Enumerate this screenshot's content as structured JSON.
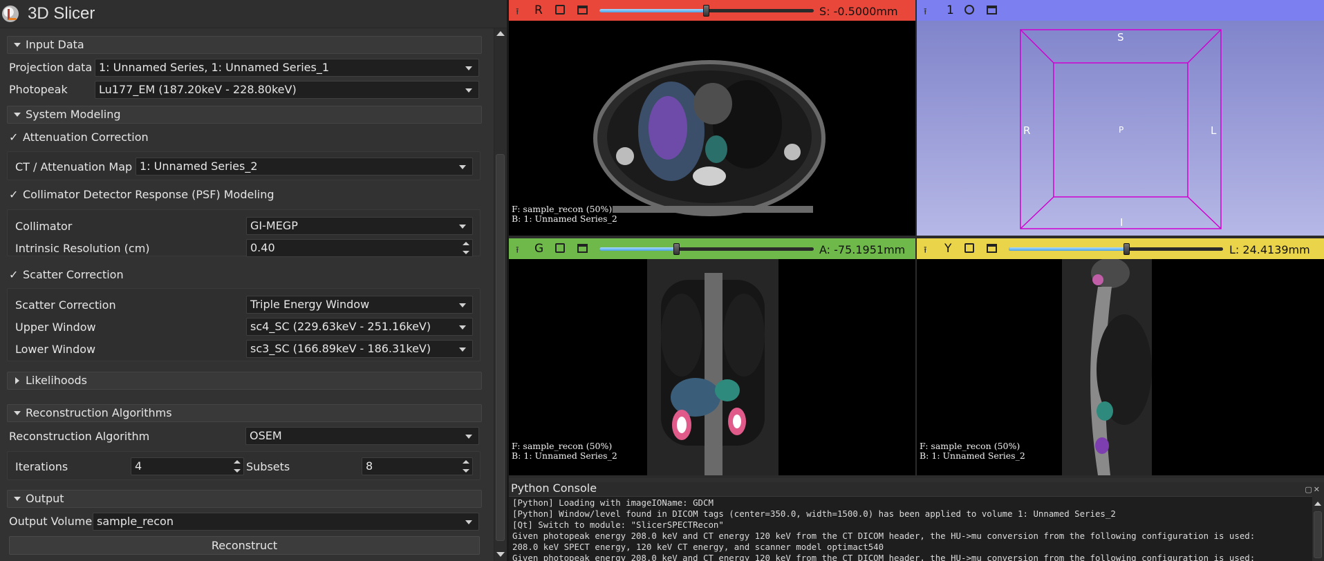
{
  "app": {
    "title": "3D Slicer"
  },
  "sections": {
    "input_data": "Input Data",
    "system_modeling": "System Modeling",
    "likelihoods": "Likelihoods",
    "reconstruction_algorithms": "Reconstruction Algorithms",
    "output": "Output"
  },
  "input_data": {
    "projection_label": "Projection data",
    "projection_value": "1: Unnamed Series, 1: Unnamed Series_1",
    "photopeak_label": "Photopeak",
    "photopeak_value": "Lu177_EM (187.20keV - 228.80keV)"
  },
  "system_modeling": {
    "attenuation_check": "✓",
    "attenuation_label": "Attenuation Correction",
    "ct_map_label": "CT / Attenuation Map",
    "ct_map_value": "1: Unnamed Series_2",
    "psf_check": "✓",
    "psf_label": "Collimator Detector Response (PSF) Modeling",
    "collimator_label": "Collimator",
    "collimator_value": "GI-MEGP",
    "intrinsic_label": "Intrinsic Resolution (cm)",
    "intrinsic_value": "0.40",
    "scatter_check": "✓",
    "scatter_label": "Scatter Correction",
    "scatter_method_label": "Scatter Correction",
    "scatter_method_value": "Triple Energy Window",
    "upper_label": "Upper Window",
    "upper_value": "sc4_SC (229.63keV - 251.16keV)",
    "lower_label": "Lower Window",
    "lower_value": "sc3_SC (166.89keV - 186.31keV)"
  },
  "reconstruction": {
    "algorithm_label": "Reconstruction Algorithm",
    "algorithm_value": "OSEM",
    "iterations_label": "Iterations",
    "iterations_value": "4",
    "subsets_label": "Subsets",
    "subsets_value": "8"
  },
  "output": {
    "volume_label": "Output Volume",
    "volume_value": "sample_recon",
    "reconstruct_label": "Reconstruct"
  },
  "views": {
    "red": {
      "label": "R",
      "offset": "S: -0.5000mm",
      "slider_fraction": 0.5,
      "color": "#e8473a",
      "fg": "F: sample_recon (50%)",
      "bg": "B: 1: Unnamed Series_2"
    },
    "three_d": {
      "label": "1",
      "color": "#7b7ff0",
      "cube_s": "S",
      "cube_r": "R",
      "cube_p": "P",
      "cube_l": "L",
      "cube_i": "I"
    },
    "green": {
      "label": "G",
      "offset": "A: -75.1951mm",
      "slider_fraction": 0.36,
      "color": "#6fb84a",
      "fg": "F: sample_recon (50%)",
      "bg": "B: 1: Unnamed Series_2"
    },
    "yellow": {
      "label": "Y",
      "offset": "L: 24.4139mm",
      "slider_fraction": 0.55,
      "color": "#e9d44a",
      "fg": "F: sample_recon (50%)",
      "bg": "B: 1: Unnamed Series_2"
    }
  },
  "console": {
    "title": "Python Console",
    "lines": [
      "[Python] Loading with imageIOName: GDCM",
      "[Python] Window/level found in DICOM tags (center=350.0, width=1500.0) has been applied to volume 1: Unnamed Series_2",
      "[Qt] Switch to module:  \"SlicerSPECTRecon\"",
      "Given photopeak energy 208.0 keV and CT energy 120 keV from the CT DICOM header, the HU->mu conversion from the following configuration is used:",
      "208.0 keV SPECT energy, 120 keV CT energy, and scanner model optimact540",
      "Given photopeak energy 208.0 keV and CT energy 120 keV from the CT DICOM header, the HU->mu conversion from the following configuration is used:"
    ]
  }
}
